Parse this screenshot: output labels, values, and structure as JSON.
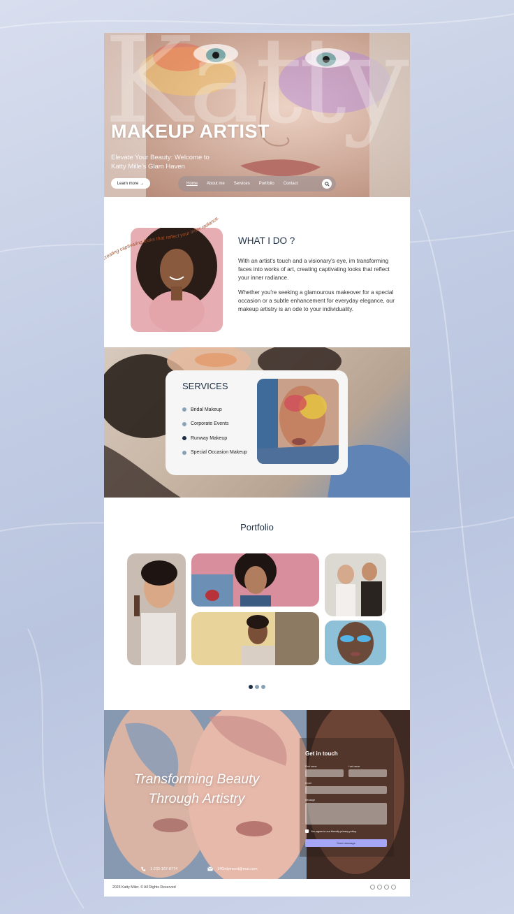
{
  "hero": {
    "watermark": "Katty",
    "title": "MAKEUP ARTIST",
    "subtitle": "Elevate Your Beauty: Welcome to Katty Mille's Glam Haven",
    "learn_more": "Learn more",
    "learn_more_arrow": "→",
    "nav": {
      "items": [
        "Home",
        "About me",
        "Services",
        "Portfolio",
        "Contact"
      ],
      "active": "Home",
      "search_icon": "search-icon"
    }
  },
  "what_i_do": {
    "arc_text": "creating captivating looks that reflect your inner radiance.",
    "heading": "WHAT I DO ?",
    "paragraph_1": "With an artist's touch and a visionary's eye, im  transforming faces into works of art, creating captivating looks that reflect your inner radiance.",
    "paragraph_2": "Whether you're seeking a glamourous makeover for a special occasion or a subtle enhancement for everyday elegance, our makeup artistry is an ode to your individuality."
  },
  "services": {
    "heading": "SERVICES",
    "items": [
      {
        "label": "Bridal Makeup",
        "dot": "#8aa2b5"
      },
      {
        "label": "Corporate Events",
        "dot": "#8aa2b5"
      },
      {
        "label": "Runway Makeup",
        "dot": "#1d2f45"
      },
      {
        "label": "Special Occasion Makeup",
        "dot": "#8aa2b5"
      }
    ]
  },
  "portfolio": {
    "heading": "Portfolio",
    "pager": {
      "count": 3,
      "active": 0
    }
  },
  "contact": {
    "tagline_line1": "Transforming Beauty",
    "tagline_line2": "Through Artistry",
    "form_title": "Get in touch",
    "first_name": "First name",
    "last_name": "Last name",
    "email": "Email",
    "message": "Message",
    "agree": "You agree to our friendly privacy policy.",
    "send": "Send message",
    "phone": "1-232-167-8774",
    "email_address": "14Onlymeed@mai.com"
  },
  "footer": {
    "copyright": "2023 Katty Miler. © All Rights Reserved"
  },
  "colors": {
    "accent": "#1d2f45",
    "dot_light": "#8aa2b5",
    "send_button": "#a5a6f5",
    "arc_text": "#a0522d"
  }
}
